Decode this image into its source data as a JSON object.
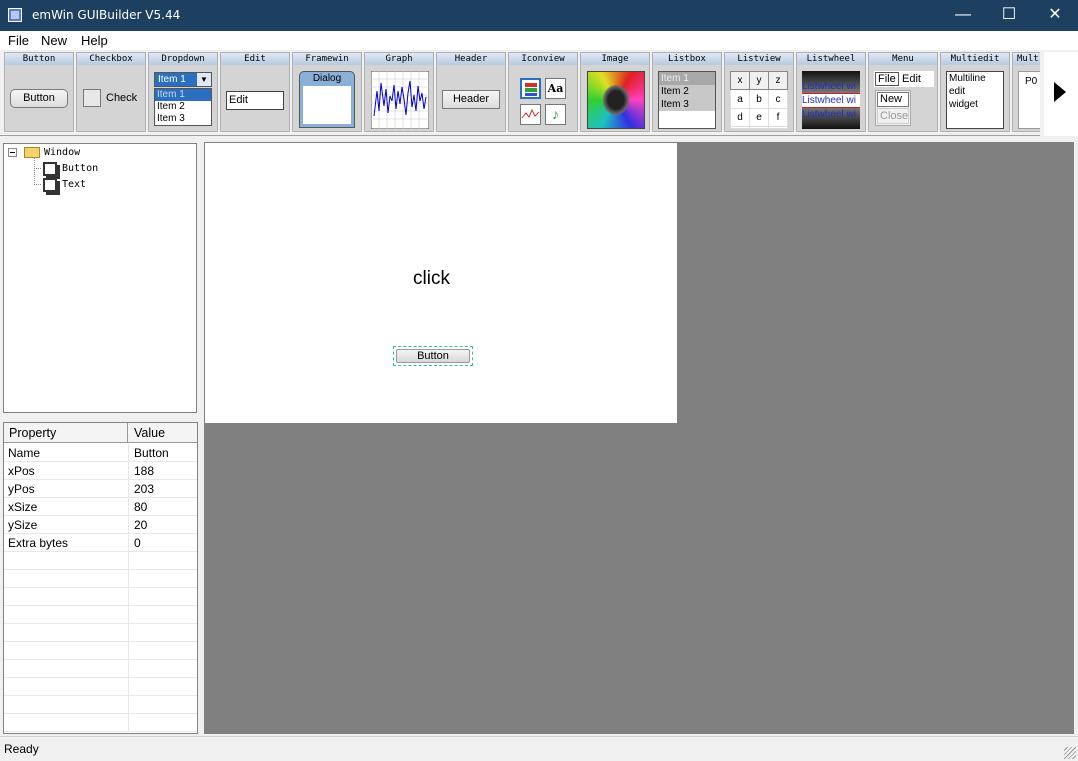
{
  "window": {
    "title": "emWin GUIBuilder V5.44",
    "minimize": "—",
    "maximize": "☐",
    "close": "✕"
  },
  "menu": [
    "File",
    "New",
    "Help"
  ],
  "toolbar": {
    "headers": [
      "Button",
      "Checkbox",
      "Dropdown",
      "Edit",
      "Framewin",
      "Graph",
      "Header",
      "Iconview",
      "Image",
      "Listbox",
      "Listview",
      "Listwheel",
      "Menu",
      "Multiedit",
      "Mult"
    ],
    "button_label": "Button",
    "checkbox_label": "Check",
    "dropdown_selected": "Item 1",
    "dropdown_items": [
      "Item 1",
      "Item 2",
      "Item 3"
    ],
    "edit_text": "Edit",
    "framewin_caption": "Dialog",
    "header_label": "Header",
    "iconview_text_icon": "Aa",
    "listbox_items": [
      "Item 1",
      "Item 2",
      "Item 3"
    ],
    "listview_cells": [
      [
        "x",
        "y",
        "z"
      ],
      [
        "a",
        "b",
        "c"
      ],
      [
        "d",
        "e",
        "f"
      ]
    ],
    "listwheel_items": [
      "Listwheel wi",
      "Listwheel wi",
      "Listwheel wi"
    ],
    "menu_items": [
      "File",
      "Edit"
    ],
    "menu_popup": [
      "New",
      "Close"
    ],
    "multiedit_lines": [
      "Multiline",
      "edit",
      "widget"
    ],
    "mult_partial": "P0"
  },
  "tree": {
    "root": "Window",
    "children": [
      "Button",
      "Text"
    ],
    "expander": "−"
  },
  "properties": {
    "headers": [
      "Property",
      "Value"
    ],
    "rows": [
      {
        "name": "Name",
        "value": "Button"
      },
      {
        "name": "xPos",
        "value": "188"
      },
      {
        "name": "yPos",
        "value": "203"
      },
      {
        "name": "xSize",
        "value": "80"
      },
      {
        "name": "ySize",
        "value": "20"
      },
      {
        "name": "Extra bytes",
        "value": "0"
      }
    ]
  },
  "dialog": {
    "text": "click",
    "button_label": "Button"
  },
  "status": "Ready",
  "colors": {
    "titlebar": "#1e4060",
    "canvas": "#808080",
    "selection": "#28c890"
  }
}
